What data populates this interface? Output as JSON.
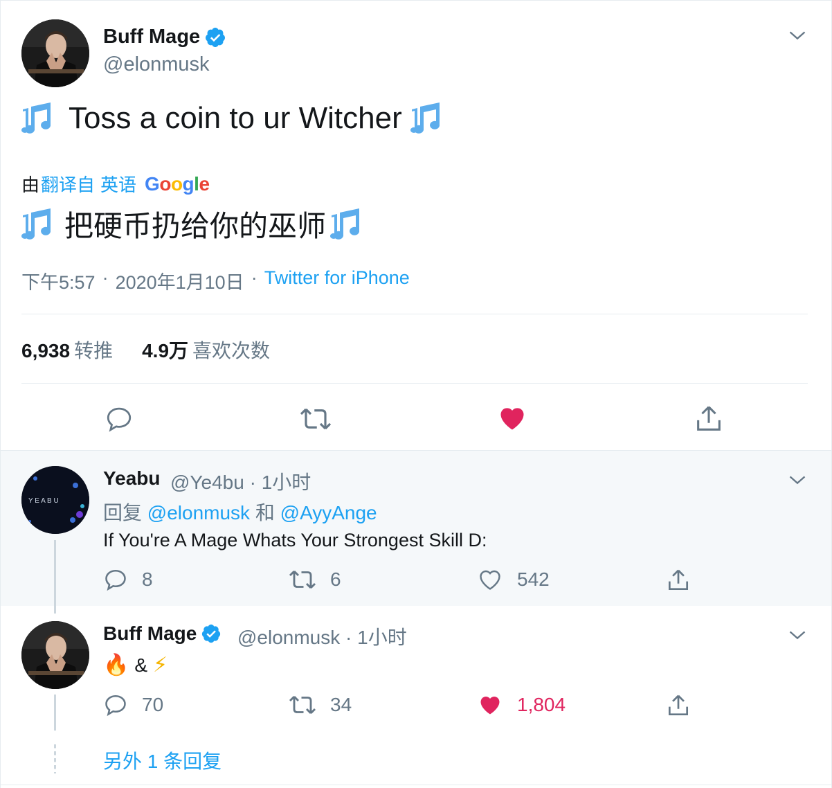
{
  "main_tweet": {
    "author_name": "Buff Mage",
    "author_handle": "@elonmusk",
    "text": "Toss a coin to ur Witcher",
    "translation_prefix": "由",
    "translation_link": "翻译自",
    "translation_lang": "英语",
    "translation_brand": "Google",
    "translated_text": "把硬币扔给你的巫师",
    "time": "下午5:57",
    "date": "2020年1月10日",
    "separator": "·",
    "source": "Twitter for iPhone",
    "retweets_count": "6,938",
    "retweets_label": "转推",
    "likes_count": "4.9万",
    "likes_label": "喜欢次数"
  },
  "reply_1": {
    "author_name": "Yeabu",
    "author_handle": "@Ye4bu",
    "separator": "·",
    "time": "1小时",
    "reply_prefix": "回复",
    "mention_1": "@elonmusk",
    "conj": "和",
    "mention_2": "@AyyAnge",
    "text": "If You're A Mage Whats Your Strongest Skill D:",
    "avatar_text": "Y E A B U",
    "replies": "8",
    "retweets": "6",
    "likes": "542"
  },
  "reply_2": {
    "author_name": "Buff Mage",
    "author_handle": "@elonmusk",
    "separator": "·",
    "time": "1小时",
    "emoji_fire": "🔥",
    "text_middle": "&",
    "emoji_bolt": "⚡",
    "replies": "70",
    "retweets": "34",
    "likes": "1,804"
  },
  "more_replies": "另外 1 条回复",
  "colors": {
    "accent": "#1da1f2",
    "like": "#e0245e",
    "muted": "#657786",
    "text": "#14171a",
    "border": "#e6ecf0"
  },
  "icons": [
    "verified-icon",
    "caret-down-icon",
    "music-note-icon",
    "reply-icon",
    "retweet-icon",
    "like-icon",
    "share-icon"
  ]
}
